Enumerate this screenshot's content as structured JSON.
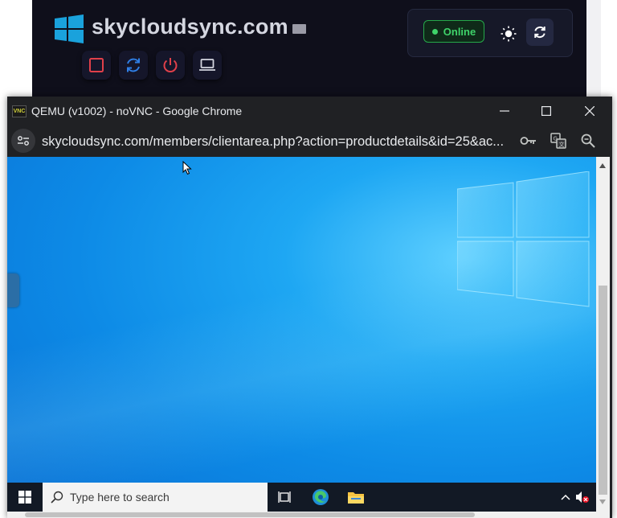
{
  "dashboard": {
    "site_title": "skycloudsync.com",
    "status_label": "Online",
    "controls": [
      "stop-icon",
      "restart-icon",
      "power-icon",
      "console-icon"
    ],
    "colors": {
      "background": "#0f0f1b",
      "online": "#3fd36a",
      "stop": "#e0404a",
      "restart": "#2f7fe6"
    }
  },
  "browser": {
    "window_title": "QEMU (v1002) - noVNC - Google Chrome",
    "favicon_text": "VNC",
    "url": "skycloudsync.com/members/clientarea.php?action=productdetails&id=25&ac..."
  },
  "remote_desktop": {
    "taskbar": {
      "search_placeholder": "Type here to search"
    },
    "wallpaper_color": "#0d8ae6"
  }
}
